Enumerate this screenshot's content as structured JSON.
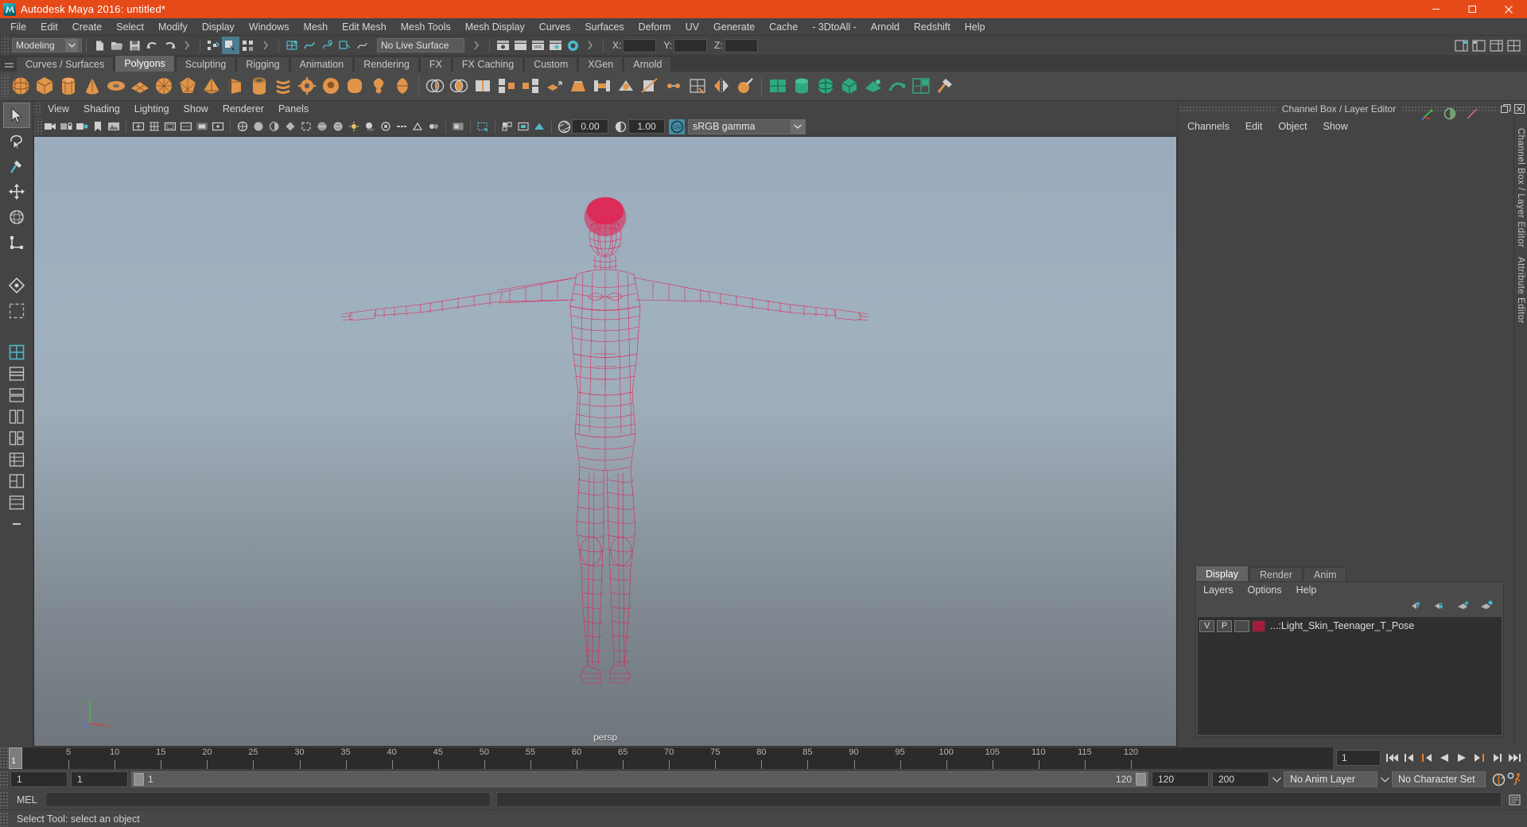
{
  "window": {
    "title": "Autodesk Maya 2016: untitled*",
    "logo_name": "maya-logo-icon",
    "minimize_label": "Minimize",
    "maximize_label": "Maximize",
    "close_label": "Close"
  },
  "menubar": {
    "items": [
      "File",
      "Edit",
      "Create",
      "Select",
      "Modify",
      "Display",
      "Windows",
      "Mesh",
      "Edit Mesh",
      "Mesh Tools",
      "Mesh Display",
      "Curves",
      "Surfaces",
      "Deform",
      "UV",
      "Generate",
      "Cache",
      "- 3DtoAll -",
      "Arnold",
      "Redshift",
      "Help"
    ]
  },
  "statusline": {
    "menu_set": "Modeling",
    "live_surface": "No Live Surface",
    "coord_x_label": "X:",
    "coord_y_label": "Y:",
    "coord_z_label": "Z:",
    "coord_x_value": "",
    "coord_y_value": "",
    "coord_z_value": "",
    "icons": [
      "new-scene-icon",
      "open-scene-icon",
      "save-scene-icon",
      "undo-icon",
      "redo-icon",
      "select-hierarchy-icon",
      "select-object-icon",
      "select-component-icon",
      "snap-grid-icon",
      "snap-curve-icon",
      "snap-point-icon",
      "snap-projected-icon",
      "snap-view-icon",
      "render-view-icon",
      "render-sequence-icon",
      "ipr-render-icon",
      "render-settings-icon",
      "hypershade-icon",
      "show-manipulator-icon",
      "sidebar-attribute-icon",
      "sidebar-tool-icon",
      "sidebar-channel-icon"
    ]
  },
  "shelf": {
    "tabs": [
      "Curves / Surfaces",
      "Polygons",
      "Sculpting",
      "Rigging",
      "Animation",
      "Rendering",
      "FX",
      "FX Caching",
      "Custom",
      "XGen",
      "Arnold"
    ],
    "active_tab": "Polygons",
    "icons": [
      "poly-sphere-icon",
      "poly-cube-icon",
      "poly-cylinder-icon",
      "poly-cone-icon",
      "poly-torus-icon",
      "poly-plane-icon",
      "poly-disc-icon",
      "poly-platonic-icon",
      "poly-pyramid-icon",
      "poly-prism-icon",
      "poly-pipe-icon",
      "poly-helix-icon",
      "poly-gear-icon",
      "poly-soccerball-icon",
      "poly-superellipse-icon",
      "poly-sphericalharmonics-icon",
      "poly-ultrashape-icon",
      "booleans-union-icon",
      "booleans-difference-icon",
      "booleans-intersection-icon",
      "combine-icon",
      "separate-icon",
      "extrude-icon",
      "bevel-icon",
      "bridge-icon",
      "smooth-icon",
      "multicut-icon",
      "target-weld-icon",
      "quad-draw-icon",
      "mirror-icon",
      "sculpt-icon",
      "uv-editor-icon",
      "cleanup-icon"
    ]
  },
  "toolbox": {
    "tools": [
      "select-tool",
      "lasso-select-tool",
      "paint-select-tool",
      "move-tool",
      "rotate-tool",
      "scale-tool",
      "soft-mod-tool",
      "show-manipulator-tool",
      "last-tool-used"
    ],
    "layouts": [
      "single-perspective-layout",
      "four-view-layout",
      "two-stacked-layout",
      "two-side-by-side-layout",
      "three-split-left-layout",
      "three-split-right-layout",
      "outliner-persp-layout",
      "hypergraph-persp-layout",
      "persp-graph-layout",
      "more-layouts"
    ]
  },
  "viewport": {
    "menu": [
      "View",
      "Shading",
      "Lighting",
      "Show",
      "Renderer",
      "Panels"
    ],
    "camera_label": "persp",
    "exposure_value": "0.00",
    "gamma_value": "1.00",
    "color_management": "sRGB gamma",
    "view_gate_toggle": "ON",
    "axis_labels": {
      "x": "x",
      "y": "y",
      "z": "z"
    },
    "toolbar_icons": [
      "select-camera-icon",
      "lock-camera-icon",
      "camera-attributes-icon",
      "bookmark-icon",
      "image-plane-icon",
      "two-d-pan-zoom-icon",
      "grid-toggle-icon",
      "film-gate-icon",
      "resolution-gate-icon",
      "gate-mask-icon",
      "film-origin-icon",
      "xray-icon",
      "xray-joints-icon",
      "wireframe-shading-icon",
      "smooth-shade-all-icon",
      "smooth-shade-selected-icon",
      "flat-shade-icon",
      "bounding-box-icon",
      "wireframe-on-shaded-icon",
      "textured-icon",
      "use-all-lights-icon",
      "shadows-icon",
      "ao-icon",
      "motion-blur-icon",
      "multisample-icon",
      "depth-of-field-icon",
      "isolate-select-icon",
      "image-based-lighting-icon",
      "exposure-icon",
      "gamma-icon",
      "color-management-toggle-icon"
    ],
    "model_name": "human-t-pose-wireframe",
    "wireframe_color": "#e6194b"
  },
  "channel_box": {
    "panel_title": "Channel Box / Layer Editor",
    "menu": [
      "Channels",
      "Edit",
      "Object",
      "Show"
    ],
    "header_icons": [
      "channel-box-icon",
      "attribute-editor-icon",
      "tool-settings-icon"
    ],
    "side_tabs": [
      "Channel Box / Layer Editor",
      "Attribute Editor"
    ]
  },
  "layer_editor": {
    "tabs": [
      "Display",
      "Render",
      "Anim"
    ],
    "active_tab": "Display",
    "menu": [
      "Layers",
      "Options",
      "Help"
    ],
    "buttons": [
      "move-layer-up-icon",
      "move-layer-down-icon",
      "new-layer-icon",
      "new-layer-from-selected-icon"
    ],
    "layers": [
      {
        "visibility": "V",
        "playback": "P",
        "shading": "",
        "color": "#a31d3a",
        "name": "...:Light_Skin_Teenager_T_Pose"
      }
    ]
  },
  "timeline": {
    "ticks": [
      "5",
      "10",
      "15",
      "20",
      "25",
      "30",
      "35",
      "40",
      "45",
      "50",
      "55",
      "60",
      "65",
      "70",
      "75",
      "80",
      "85",
      "90",
      "95",
      "100",
      "105",
      "110",
      "115",
      "120"
    ],
    "current_frame": "1",
    "current_frame_field": "1",
    "playback_buttons": [
      "go-to-start-icon",
      "step-back-frame-icon",
      "step-back-key-icon",
      "play-backwards-icon",
      "play-forwards-icon",
      "step-forward-key-icon",
      "step-forward-frame-icon",
      "go-to-end-icon"
    ]
  },
  "range": {
    "start_field": "1",
    "end_field": "1",
    "range_start_label": "1",
    "range_end_label": "120",
    "playback_end": "120",
    "animation_end": "200",
    "anim_layer": "No Anim Layer",
    "character_set": "No Character Set",
    "auto_key_icon": "auto-keyframe-icon",
    "anim_prefs_icon": "animation-preferences-icon"
  },
  "command_line": {
    "language_label": "MEL",
    "input_value": "",
    "output_value": ""
  },
  "status": {
    "message": "Select Tool: select an object",
    "help_icon": "help-line-icon"
  },
  "colors": {
    "title_bar": "#e64a19",
    "chrome": "#444444",
    "accent_teal": "#45b0c4",
    "shelf_orange": "#e0954a",
    "wireframe": "#e6194b"
  }
}
